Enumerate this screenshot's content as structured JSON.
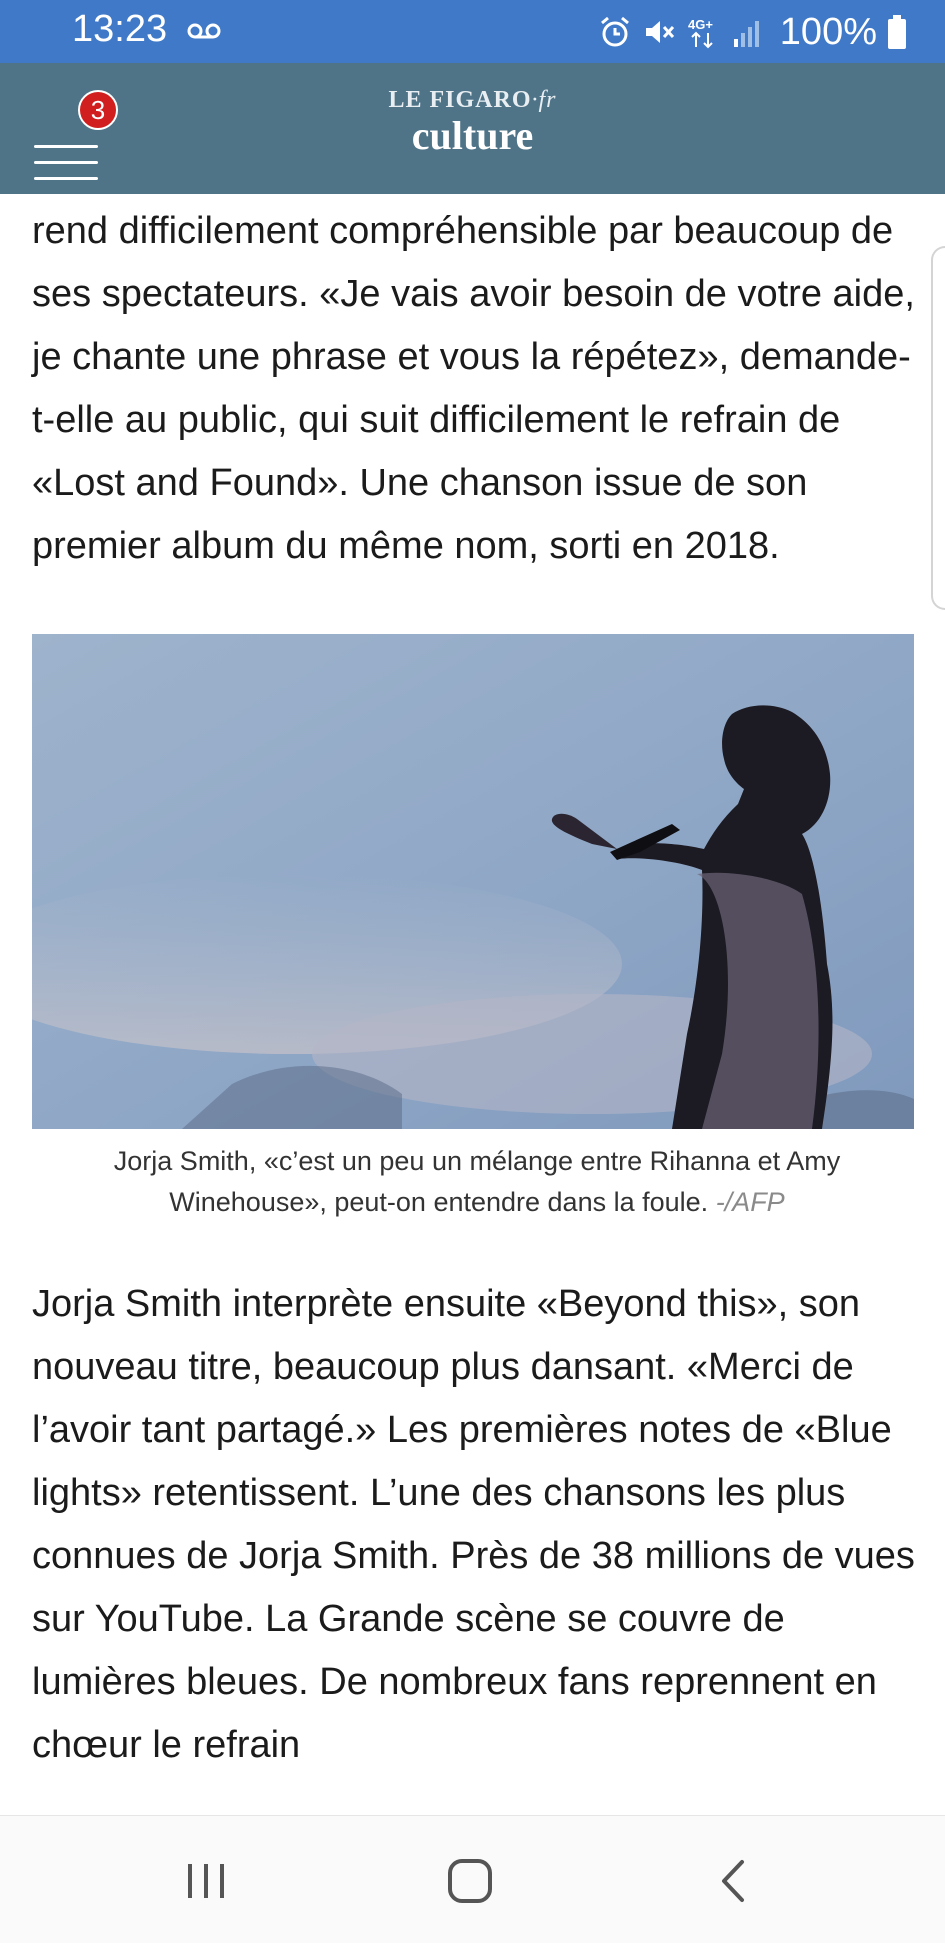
{
  "status_bar": {
    "time": "13:23",
    "battery": "100%",
    "network": "4G+",
    "icons": [
      "voicemail-icon",
      "alarm-icon",
      "mute-icon",
      "network-4g-icon",
      "signal-icon",
      "battery-icon"
    ]
  },
  "header": {
    "brand": "LE FIGARO",
    "brand_suffix": "·fr",
    "section": "culture",
    "notification_count": "3",
    "background": "#4f7488"
  },
  "article": {
    "paragraph_1": "rend difficilement compréhensible par beaucoup de ses spectateurs. «Je vais avoir besoin de votre aide, je chante une phrase et vous la répétez», demande-t-elle au public, qui suit difficilement le refrain de «Lost and Found». Une chanson issue de son premier album du même nom, sorti en 2018.",
    "caption": "Jorja Smith, «c’est un peu un mélange entre Rihanna et Amy Winehouse», peut-on entendre dans la foule.",
    "caption_credit": "-/AFP",
    "paragraph_2": "Jorja Smith interprète ensuite «Beyond this», son nouveau titre, beaucoup plus dansant. «Merci de l’avoir tant partagé.» Les premières notes de «Blue lights» retentissent. L’une des chansons les plus connues de Jorja Smith. Près de 38 millions de vues sur YouTube. La Grande scène se couvre de lumières bleues. De nombreux fans reprennent en chœur le refrain"
  },
  "nav_bar": {
    "buttons": [
      "recent-apps",
      "home",
      "back"
    ]
  },
  "colors": {
    "status_bar": "#3f79c8",
    "badge": "#d11f1f",
    "text": "#1b1b1b"
  }
}
